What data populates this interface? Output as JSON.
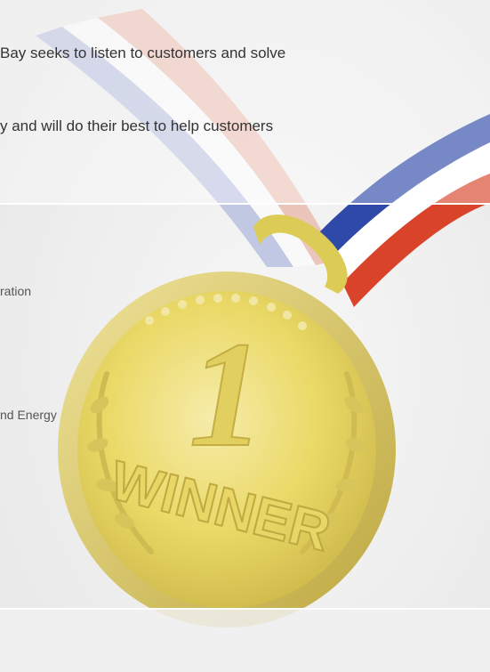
{
  "intro": {
    "line1": "Bay seeks to listen to customers and solve",
    "line2": "y and will do their best to help customers"
  },
  "list": {
    "item1": "ration",
    "item2": "nd Energy"
  },
  "medal": {
    "number": "1",
    "word": "WINNER"
  },
  "colors": {
    "ribbon_blue": "#2f49a8",
    "ribbon_red": "#d9432a",
    "ribbon_white": "#ffffff",
    "medal_gold": "#e9d85c",
    "page_bg": "#efefef"
  }
}
